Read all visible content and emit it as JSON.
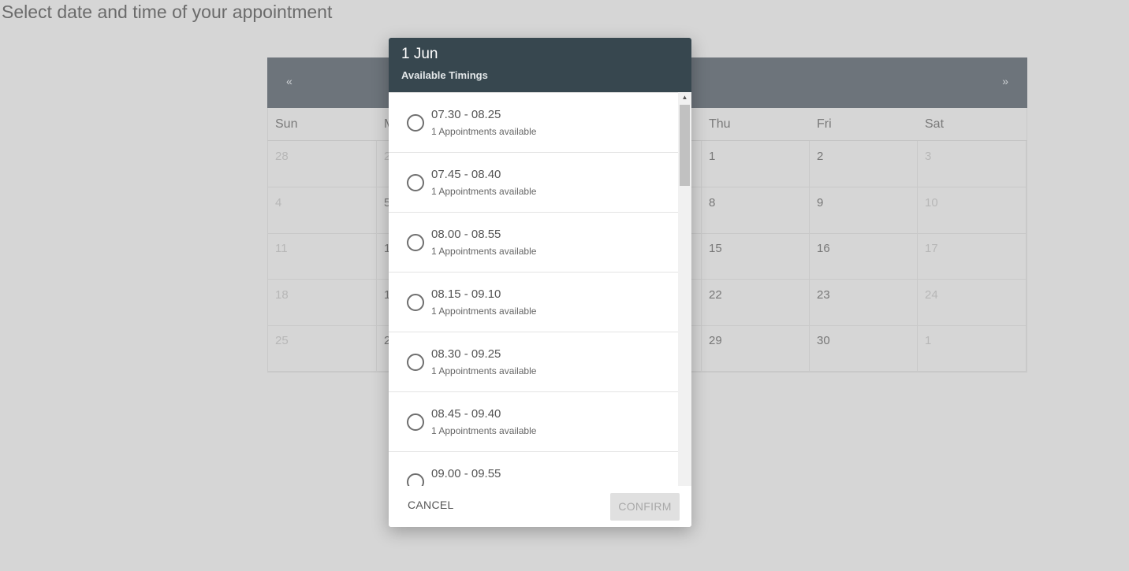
{
  "page": {
    "heading": "Select date and time of your appointment"
  },
  "calendar": {
    "prev_label": "«",
    "next_label": "»",
    "weekdays": [
      "Sun",
      "M",
      "",
      "",
      "Thu",
      "Fri",
      "Sat"
    ],
    "weeks": [
      [
        "28",
        "2",
        "",
        "",
        "1",
        "2",
        "3"
      ],
      [
        "4",
        "5",
        "",
        "",
        "8",
        "9",
        "10"
      ],
      [
        "11",
        "1",
        "",
        "",
        "15",
        "16",
        "17"
      ],
      [
        "18",
        "1",
        "",
        "",
        "22",
        "23",
        "24"
      ],
      [
        "25",
        "2",
        "",
        "",
        "29",
        "30",
        "1"
      ]
    ]
  },
  "dialog": {
    "date": "1 Jun",
    "subtitle": "Available Timings",
    "slots": [
      {
        "time": "07.30 - 08.25",
        "availability": "1 Appointments available"
      },
      {
        "time": "07.45 - 08.40",
        "availability": "1 Appointments available"
      },
      {
        "time": "08.00 - 08.55",
        "availability": "1 Appointments available"
      },
      {
        "time": "08.15 - 09.10",
        "availability": "1 Appointments available"
      },
      {
        "time": "08.30 - 09.25",
        "availability": "1 Appointments available"
      },
      {
        "time": "08.45 - 09.40",
        "availability": "1 Appointments available"
      },
      {
        "time": "09.00 - 09.55",
        "availability": ""
      }
    ],
    "cancel_label": "CANCEL",
    "confirm_label": "CONFIRM",
    "scroll_up": "▲",
    "scroll_down": "▼"
  },
  "colors": {
    "dialog_header": "#37474f",
    "calendar_header": "#6d747b",
    "backdrop": "#d6d6d6"
  }
}
